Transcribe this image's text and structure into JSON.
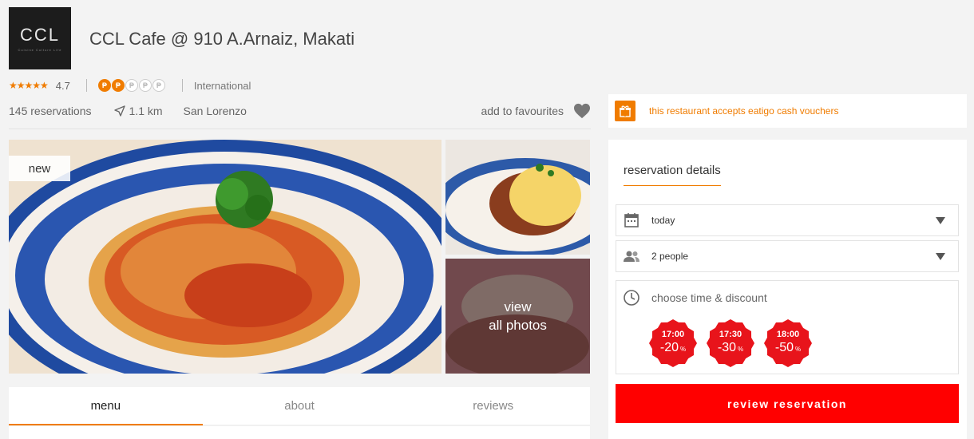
{
  "restaurant": {
    "logo_text": "CCL",
    "logo_subtext": "Cuisine Culture Life",
    "name": "CCL Cafe @ 910 A.Arnaiz, Makati",
    "stars": "★★★★★",
    "rating": "4.7",
    "price_level": 2,
    "price_max": 5,
    "price_symbol": "₱",
    "cuisine": "International",
    "reservations": "145 reservations",
    "distance": "1.1 km",
    "area": "San Lorenzo",
    "favourite_label": "add to favourites"
  },
  "photos": {
    "badge": "new",
    "view_all_line1": "view",
    "view_all_line2": "all photos"
  },
  "tabs": [
    {
      "label": "menu",
      "active": true
    },
    {
      "label": "about",
      "active": false
    },
    {
      "label": "reviews",
      "active": false
    }
  ],
  "voucher": {
    "text": "this restaurant accepts eatigo cash vouchers"
  },
  "reservation": {
    "heading": "reservation details",
    "date_value": "today",
    "people_value": "2 people",
    "time_label": "choose time & discount",
    "slots": [
      {
        "time": "17:00",
        "discount": "-20",
        "unit": "%"
      },
      {
        "time": "17:30",
        "discount": "-30",
        "unit": "%"
      },
      {
        "time": "18:00",
        "discount": "-50",
        "unit": "%"
      }
    ],
    "button_label": "review reservation"
  },
  "colors": {
    "accent": "#f07c00",
    "primary_button": "#ff0000",
    "discount_badge": "#e8141b"
  }
}
